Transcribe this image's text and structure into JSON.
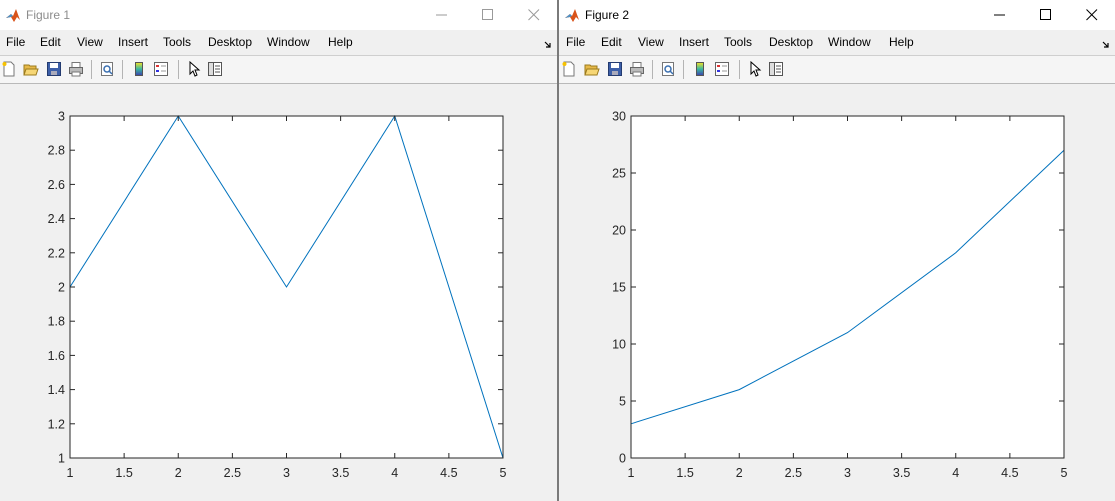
{
  "windows": [
    {
      "title": "Figure 1",
      "menu": [
        "File",
        "Edit",
        "View",
        "Insert",
        "Tools",
        "Desktop",
        "Window",
        "Help"
      ],
      "toolbar_icons": [
        "new-figure-icon",
        "open-file-icon",
        "save-icon",
        "print-icon",
        "print-preview-icon",
        "colorbar-icon",
        "legend-icon",
        "edit-plot-arrow-icon",
        "property-inspector-icon"
      ]
    },
    {
      "title": "Figure 2",
      "menu": [
        "File",
        "Edit",
        "View",
        "Insert",
        "Tools",
        "Desktop",
        "Window",
        "Help"
      ],
      "toolbar_icons": [
        "new-figure-icon",
        "open-file-icon",
        "save-icon",
        "print-icon",
        "print-preview-icon",
        "colorbar-icon",
        "legend-icon",
        "edit-plot-arrow-icon",
        "property-inspector-icon"
      ]
    }
  ],
  "colors": {
    "line": "#0072BD",
    "axes": "#262626",
    "title_inactive": "#8c8c8c"
  },
  "chart_data": [
    {
      "type": "line",
      "x": [
        1,
        2,
        3,
        4,
        5
      ],
      "series": [
        {
          "values": [
            2,
            3,
            2,
            3,
            1
          ]
        }
      ],
      "xlim": [
        1,
        5
      ],
      "ylim": [
        1,
        3
      ],
      "xticks": [
        "1",
        "1.5",
        "2",
        "2.5",
        "3",
        "3.5",
        "4",
        "4.5",
        "5"
      ],
      "yticks": [
        "1",
        "1.2",
        "1.4",
        "1.6",
        "1.8",
        "2",
        "2.2",
        "2.4",
        "2.6",
        "2.8",
        "3"
      ],
      "grid": false
    },
    {
      "type": "line",
      "x": [
        1,
        2,
        3,
        4,
        5
      ],
      "series": [
        {
          "values": [
            3,
            6,
            11,
            18,
            27
          ]
        }
      ],
      "xlim": [
        1,
        5
      ],
      "ylim": [
        0,
        30
      ],
      "xticks": [
        "1",
        "1.5",
        "2",
        "2.5",
        "3",
        "3.5",
        "4",
        "4.5",
        "5"
      ],
      "yticks": [
        "0",
        "5",
        "10",
        "15",
        "20",
        "25",
        "30"
      ],
      "grid": false
    }
  ]
}
